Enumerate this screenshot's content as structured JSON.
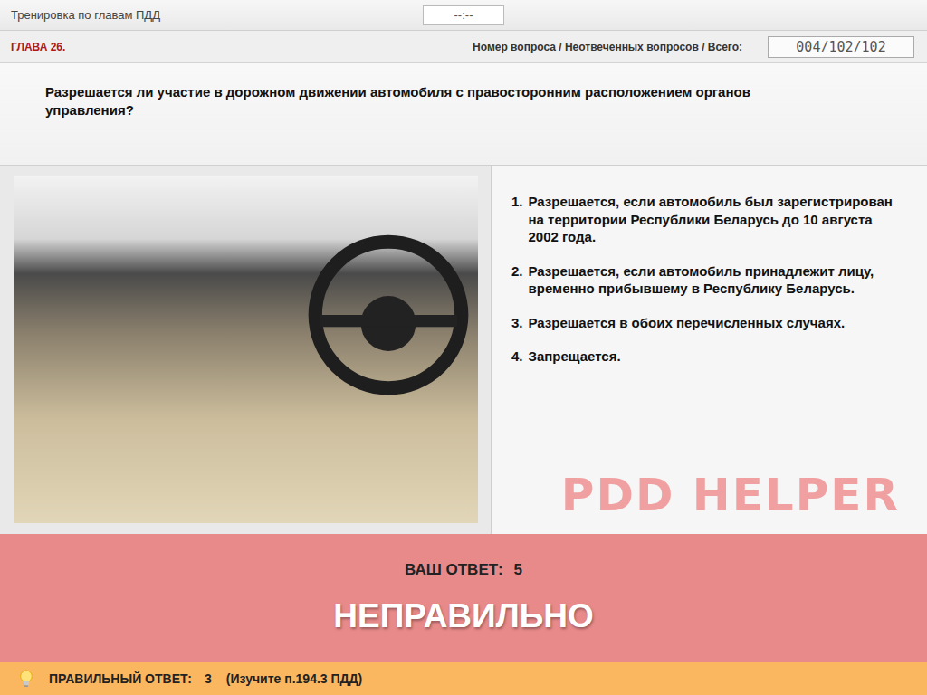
{
  "header": {
    "title": "Тренировка по главам ПДД",
    "timer": "--:--"
  },
  "chapter": "ГЛАВА 26.",
  "counter": {
    "label": "Номер вопроса / Неотвеченных вопросов / Всего:",
    "value": "004/102/102"
  },
  "question": "Разрешается ли участие в дорожном движении автомобиля с правосторонним расположением органов управления?",
  "answers": [
    {
      "number": "1.",
      "text": "Разрешается, если автомобиль был зарегистрирован на территории Республики Беларусь до 10 августа 2002 года."
    },
    {
      "number": "2.",
      "text": "Разрешается, если автомобиль принадлежит лицу, временно прибывшему в Республику Беларусь."
    },
    {
      "number": "3.",
      "text": "Разрешается в обоих перечисленных случаях."
    },
    {
      "number": "4.",
      "text": "Запрещается."
    }
  ],
  "watermark": "PDD HELPER",
  "result": {
    "your_answer_label": "ВАШ ОТВЕТ:",
    "your_answer": "5",
    "verdict": "НЕПРАВИЛЬНО",
    "correct": false
  },
  "hint": {
    "label": "ПРАВИЛЬНЫЙ ОТВЕТ:",
    "answer": "3",
    "reference": "(Изучите п.194.3 ПДД)"
  }
}
